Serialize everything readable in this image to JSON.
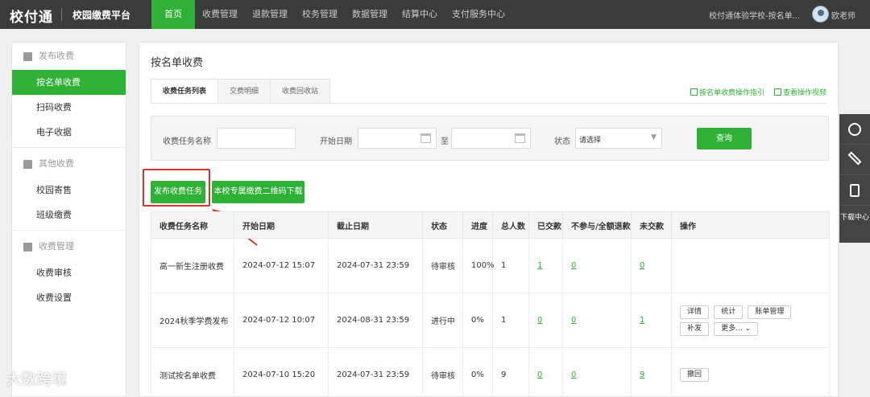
{
  "header": {
    "logo": "校付通",
    "platform": "校园缴费平台",
    "nav": [
      "首页",
      "收费管理",
      "退款管理",
      "校务管理",
      "数据管理",
      "结算中心",
      "支付服务中心"
    ],
    "school": "校付通体验学校-按名单...",
    "user": "欧老师"
  },
  "sidebar": {
    "groups": [
      {
        "title": "发布收费",
        "items": [
          "按名单收费",
          "扫码收费",
          "电子收据"
        ]
      },
      {
        "title": "其他收费",
        "items": [
          "校园寄售",
          "班级缴费"
        ]
      },
      {
        "title": "收费管理",
        "items": [
          "收费审核",
          "收费设置"
        ]
      }
    ]
  },
  "main": {
    "title": "按名单收费",
    "tabs": [
      "收费任务列表",
      "交费明细",
      "收费回收站"
    ],
    "links": [
      "按名单收费操作指引",
      "查看操作视频"
    ],
    "filter": {
      "name_label": "收费任务名称",
      "start_label": "开始日期",
      "to_label": "至",
      "status_label": "状态",
      "status_value": "请选择",
      "query": "查询"
    },
    "publish_btn": "发布收费任务",
    "qr_btn": "本校专属缴费二维码下载",
    "columns": [
      "收费任务名称",
      "开始日期",
      "截止日期",
      "状态",
      "进度",
      "总人数",
      "已交款",
      "不参与/全额退款",
      "未交款",
      "操作"
    ],
    "rows": [
      {
        "name": "高一新生注册收费",
        "start": "2024-07-12 15:07",
        "end": "2024-07-31 23:59",
        "status": "待审核",
        "progress": "100%",
        "total": "1",
        "paid": "1",
        "refund": "0",
        "unpaid": "0",
        "ops": []
      },
      {
        "name": "2024秋季学费发布",
        "start": "2024-07-12 10:07",
        "end": "2024-08-31 23:59",
        "status": "进行中",
        "progress": "0%",
        "total": "1",
        "paid": "0",
        "refund": "0",
        "unpaid": "1",
        "ops": [
          "详情",
          "统计",
          "账单管理",
          "补发",
          "更多..."
        ]
      },
      {
        "name": "测试按名单收费",
        "start": "2024-07-10 15:20",
        "end": "2024-07-31 23:59",
        "status": "待审核",
        "progress": "0%",
        "total": "9",
        "paid": "0",
        "refund": "0",
        "unpaid": "9",
        "ops": [
          "撤回"
        ]
      }
    ]
  },
  "floatbar": {
    "download": "下载中心"
  },
  "watermark": "大数跨境",
  "colors": {
    "accent": "#2eb135",
    "topbar": "#3b3b3b",
    "highlight": "#d9342b"
  }
}
